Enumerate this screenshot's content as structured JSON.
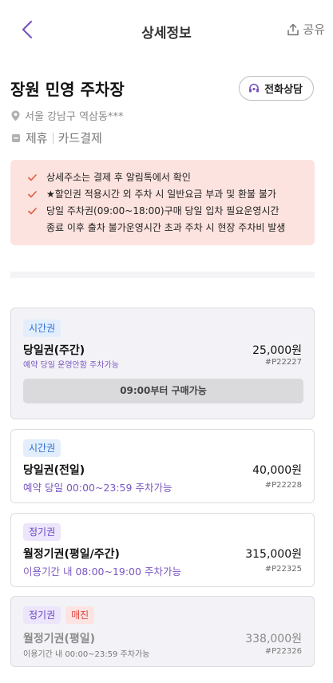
{
  "header": {
    "title": "상세정보",
    "share_label": "공유",
    "back_icon": "chevron-left-icon",
    "share_icon": "share-upload-icon"
  },
  "lot": {
    "name": "장원 민영 주차장",
    "address": "서울 강남구 역삼동***",
    "tags": [
      "제휴",
      "카드결제"
    ],
    "call_label": "전화상담"
  },
  "notice": {
    "items": [
      "상세주소는 결제 후 알림톡에서 확인",
      "★할인권 적용시간 외 주차 시 일반요금 부과 및 환불 불가",
      "당일 주차권(09:00~18:00)구매 당일 입차 필요운영시간"
    ],
    "continuation": "종료 이후 출차 불가운영시간 초과 주차 시 현장 주차비 발생"
  },
  "products": [
    {
      "badges": [
        "시간권"
      ],
      "name": "당일권(주간)",
      "price": "25,000원",
      "desc": "예약 당일 운영안함 주차가능",
      "code": "#P22227",
      "button": "09:00부터 구매가능"
    },
    {
      "badges": [
        "시간권"
      ],
      "name": "당일권(전일)",
      "price": "40,000원",
      "desc": "예약 당일 00:00~23:59 주차가능",
      "code": "#P22228"
    },
    {
      "badges": [
        "정기권"
      ],
      "name": "월정기권(평일/주간)",
      "price": "315,000원",
      "desc": "이용기간 내 08:00~19:00 주차가능",
      "code": "#P22325"
    },
    {
      "badges": [
        "정기권",
        "매진"
      ],
      "name": "월정기권(평일)",
      "price": "338,000원",
      "desc": "이용기간 내 00:00~23:59 주차가능",
      "code": "#P22326"
    }
  ],
  "colors": {
    "accent": "#7a56c0",
    "notice_bg": "#fde3df",
    "check": "#e05a3a"
  }
}
